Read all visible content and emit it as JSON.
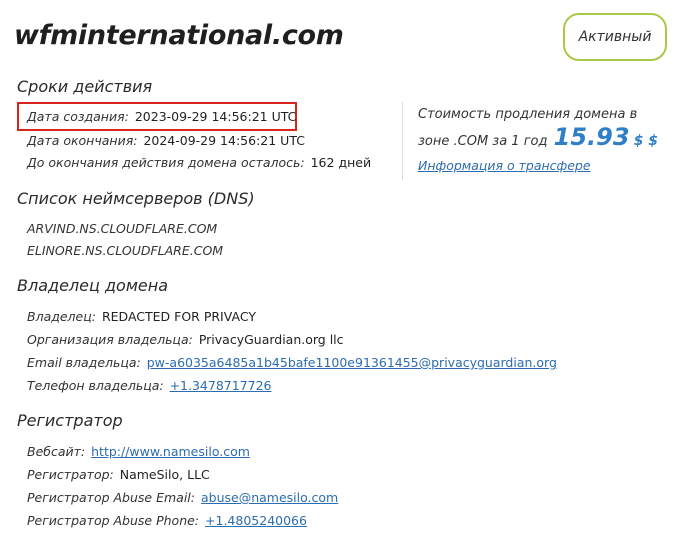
{
  "domain": "wfminternational.com",
  "status": "Активный",
  "validity": {
    "title": "Сроки действия",
    "created_label": "Дата создания:",
    "created_value": "2023-09-29 14:56:21 UTC",
    "expires_label": "Дата окончания:",
    "expires_value": "2024-09-29 14:56:21 UTC",
    "remaining_label": "До окончания действия домена осталось:",
    "remaining_value": "162 дней"
  },
  "renewal": {
    "text_line1": "Стоимость продления домена в",
    "text_line2": "зоне .COM за 1 год",
    "price": "15.93",
    "currency": "$ $",
    "transfer_link": "Информация о трансфере"
  },
  "dns": {
    "title": "Список неймсерверов (DNS)",
    "servers": [
      "ARVIND.NS.CLOUDFLARE.COM",
      "ELINORE.NS.CLOUDFLARE.COM"
    ]
  },
  "owner": {
    "title": "Владелец домена",
    "owner_label": "Владелец:",
    "owner_value": "REDACTED FOR PRIVACY",
    "org_label": "Организация владельца:",
    "org_value": "PrivacyGuardian.org llc",
    "email_label": "Email владельца:",
    "email_value": "pw-a6035a6485a1b45bafe1100e91361455@privacyguardian.org",
    "phone_label": "Телефон владельца:",
    "phone_value": "+1.3478717726"
  },
  "registrar": {
    "title": "Регистратор",
    "website_label": "Вебсайт:",
    "website_value": "http://www.namesilo.com",
    "registrar_label": "Регистратор:",
    "registrar_value": "NameSilo, LLC",
    "abuse_email_label": "Регистратор Abuse Email:",
    "abuse_email_value": "abuse@namesilo.com",
    "abuse_phone_label": "Регистратор Abuse Phone:",
    "abuse_phone_value": "+1.4805240066"
  },
  "colors": {
    "highlight": "#d9251d",
    "badge_border": "#a9c84a",
    "link": "#2c6cb0",
    "price": "#2f7fc8"
  }
}
